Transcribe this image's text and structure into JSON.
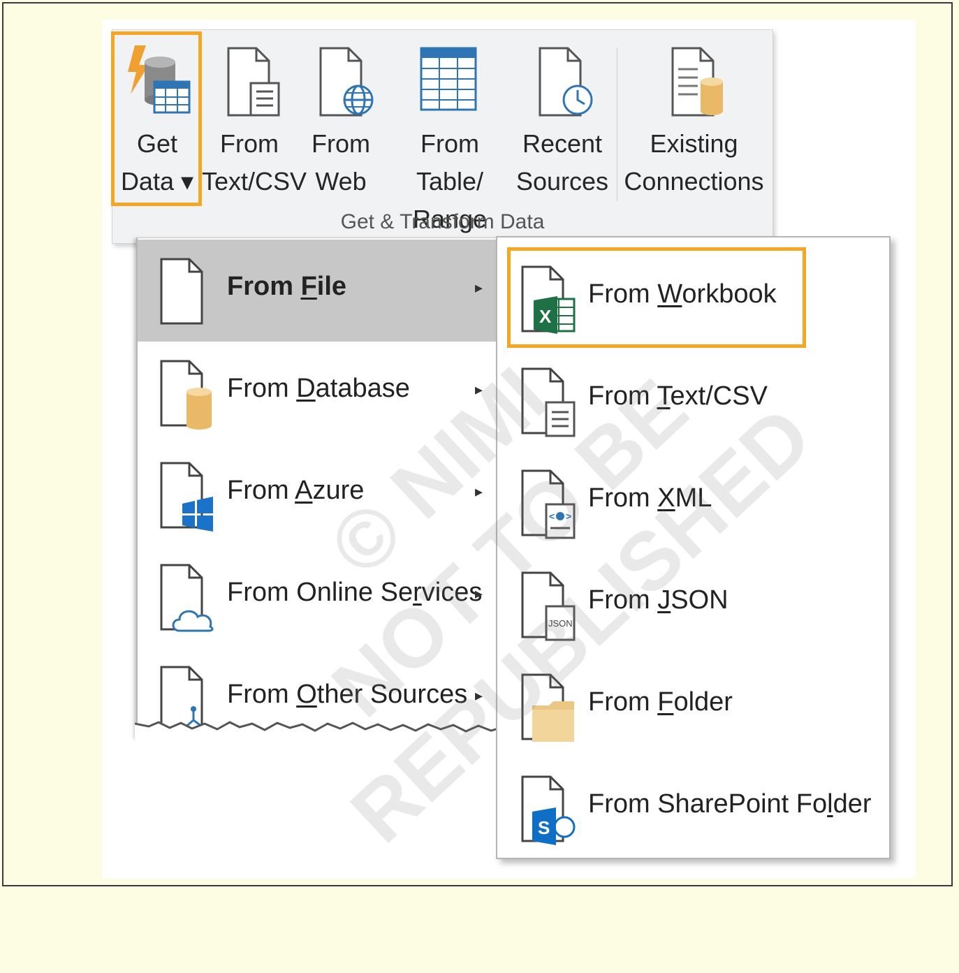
{
  "ribbon": {
    "buttons": [
      {
        "label": "Get\nData ▾",
        "icon": "get-data-icon"
      },
      {
        "label": "From\nText/CSV",
        "icon": "text-csv-file-icon"
      },
      {
        "label": "From\nWeb",
        "icon": "web-file-icon"
      },
      {
        "label": "From Table/\nRange",
        "icon": "table-icon"
      },
      {
        "label": "Recent\nSources",
        "icon": "recent-file-icon"
      },
      {
        "label": "Existing\nConnections",
        "icon": "existing-connections-icon"
      }
    ],
    "group_label": "Get & Transform Data"
  },
  "menu": {
    "items": [
      {
        "pre": "From ",
        "key": "F",
        "post": "ile",
        "icon": "file-icon",
        "active": true
      },
      {
        "pre": "From ",
        "key": "D",
        "post": "atabase",
        "icon": "database-icon"
      },
      {
        "pre": "From ",
        "key": "A",
        "post": "zure",
        "icon": "azure-icon"
      },
      {
        "pre": "From Online Se",
        "key": "r",
        "post": "vices",
        "icon": "cloud-icon"
      },
      {
        "pre": "From ",
        "key": "O",
        "post": "ther Sources",
        "icon": "other-sources-icon"
      }
    ],
    "arrow": "▸"
  },
  "submenu": {
    "items": [
      {
        "pre": "From ",
        "key": "W",
        "post": "orkbook",
        "icon": "excel-icon"
      },
      {
        "pre": "From ",
        "key": "T",
        "post": "ext/CSV",
        "icon": "text-csv-icon"
      },
      {
        "pre": "From ",
        "key": "X",
        "post": "ML",
        "icon": "xml-icon"
      },
      {
        "pre": "From ",
        "key": "J",
        "post": "SON",
        "icon": "json-icon"
      },
      {
        "pre": "From ",
        "key": "F",
        "post": "older",
        "icon": "folder-icon"
      },
      {
        "pre": "From SharePoint Fo",
        "key": "l",
        "post": "der",
        "icon": "sharepoint-icon"
      }
    ]
  },
  "watermark": "© NIMI\nNOT TO BE REPUBLISHED",
  "colors": {
    "highlight": "#f5a623",
    "active_bg": "#c7c7c7",
    "excel_green": "#1e7145",
    "sharepoint_blue": "#0f6fc6",
    "folder_tan": "#eac784"
  }
}
